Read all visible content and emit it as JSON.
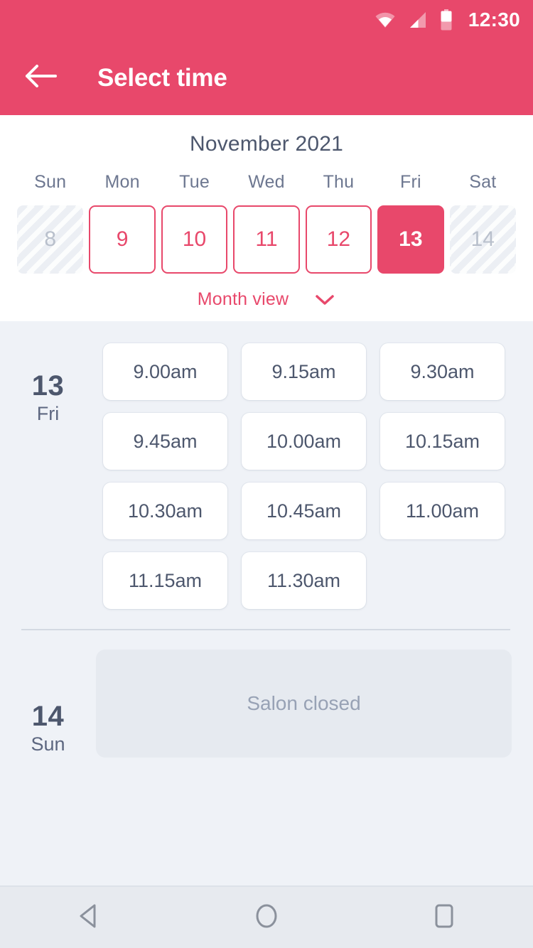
{
  "theme": {
    "accent": "#e8486b",
    "page_bg": "#eff2f7",
    "panel_bg": "#ffffff",
    "text_dark": "#4d576d",
    "text_muted": "#98a2b5",
    "disabled_cell_bg": "#eceff4"
  },
  "statusbar": {
    "time": "12:30",
    "icons": [
      "wifi-icon",
      "signal-icon",
      "battery-icon"
    ]
  },
  "appbar": {
    "back_icon": "back-arrow-icon",
    "title": "Select time"
  },
  "calendar": {
    "month_title": "November 2021",
    "weekdays": [
      "Sun",
      "Mon",
      "Tue",
      "Wed",
      "Thu",
      "Fri",
      "Sat"
    ],
    "days": [
      {
        "num": "8",
        "state": "disabled"
      },
      {
        "num": "9",
        "state": "enabled"
      },
      {
        "num": "10",
        "state": "enabled"
      },
      {
        "num": "11",
        "state": "enabled"
      },
      {
        "num": "12",
        "state": "enabled"
      },
      {
        "num": "13",
        "state": "selected"
      },
      {
        "num": "14",
        "state": "disabled"
      }
    ],
    "month_view_label": "Month view",
    "month_view_icon": "chevron-down-icon"
  },
  "schedule": [
    {
      "day_num": "13",
      "day_dow": "Fri",
      "slots": [
        "9.00am",
        "9.15am",
        "9.30am",
        "9.45am",
        "10.00am",
        "10.15am",
        "10.30am",
        "10.45am",
        "11.00am",
        "11.15am",
        "11.30am"
      ]
    },
    {
      "day_num": "14",
      "day_dow": "Sun",
      "closed_label": "Salon closed"
    }
  ],
  "navbar": {
    "back_label": "back-triangle-icon",
    "home_label": "home-circle-icon",
    "recents_label": "recents-square-icon"
  }
}
